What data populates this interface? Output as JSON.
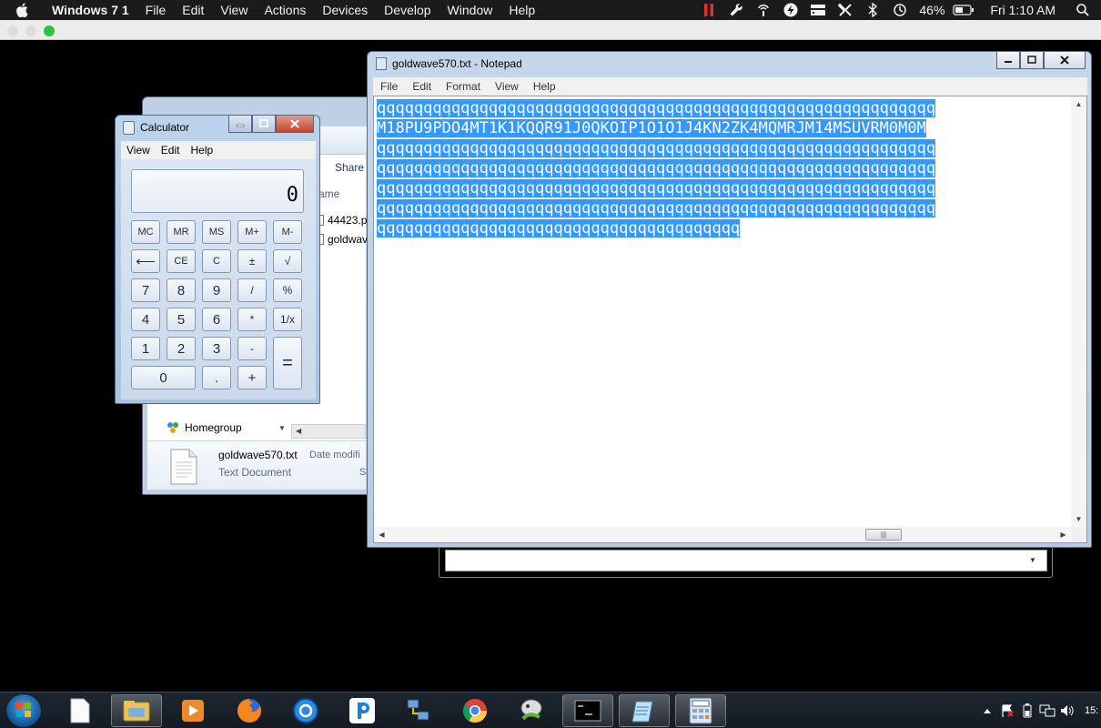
{
  "mac": {
    "app_name": "Windows 7 1",
    "menus": [
      "File",
      "Edit",
      "View",
      "Actions",
      "Devices",
      "Develop",
      "Window",
      "Help"
    ],
    "battery": "46%",
    "clock": "Fri 1:10 AM"
  },
  "explorer": {
    "share_label": "Share",
    "column_header": "ame",
    "files": [
      "44423.p",
      "goldwav"
    ],
    "homegroup_label": "Homegroup",
    "details": {
      "file_name": "goldwave570.txt",
      "file_type": "Text Document",
      "date_modified_label": "Date modifi",
      "size_label": "S"
    }
  },
  "calculator": {
    "title": "Calculator",
    "menus": [
      "View",
      "Edit",
      "Help"
    ],
    "display_value": "0",
    "buttons": {
      "mc": "MC",
      "mr": "MR",
      "ms": "MS",
      "mplus": "M+",
      "mminus": "M-",
      "backspace": "⟵",
      "ce": "CE",
      "c": "C",
      "plusminus": "±",
      "sqrt": "√",
      "n7": "7",
      "n8": "8",
      "n9": "9",
      "divide": "/",
      "percent": "%",
      "n4": "4",
      "n5": "5",
      "n6": "6",
      "multiply": "*",
      "reciprocal": "1/x",
      "n1": "1",
      "n2": "2",
      "n3": "3",
      "minus": "-",
      "equals": "=",
      "n0": "0",
      "dot": ".",
      "plus": "+"
    }
  },
  "notepad": {
    "title": "goldwave570.txt - Notepad",
    "menus": [
      "File",
      "Edit",
      "Format",
      "View",
      "Help"
    ],
    "lines": [
      "qqqqqqqqqqqqqqqqqqqqqqqqqqqqqqqqqqqqqqqqqqqqqqqqqqqqqqqqqqqq",
      "M18PU9PDO4MT1K1KQQR91J0QKOIP1O1O1J4KN2ZK4MQMRJM14MSUVRM0M0M",
      "qqqqqqqqqqqqqqqqqqqqqqqqqqqqqqqqqqqqqqqqqqqqqqqqqqqqqqqqqqqq",
      "qqqqqqqqqqqqqqqqqqqqqqqqqqqqqqqqqqqqqqqqqqqqqqqqqqqqqqqqqqqq",
      "qqqqqqqqqqqqqqqqqqqqqqqqqqqqqqqqqqqqqqqqqqqqqqqqqqqqqqqqqqqq",
      "qqqqqqqqqqqqqqqqqqqqqqqqqqqqqqqqqqqqqqqqqqqqqqqqqqqqqqqqqqqq",
      "qqqqqqqqqqqqqqqqqqqqqqqqqqqqqqqqqqqqqqq"
    ],
    "scroll_thumb_grip": "|||"
  },
  "taskbar": {
    "icons": [
      "start-orb",
      "blank-document",
      "file-explorer",
      "media-player",
      "firefox",
      "network-tool",
      "p-app",
      "network-connection",
      "chrome",
      "paint-utility",
      "command-prompt",
      "notepad",
      "calculator"
    ],
    "clock_fragment": "15:"
  }
}
